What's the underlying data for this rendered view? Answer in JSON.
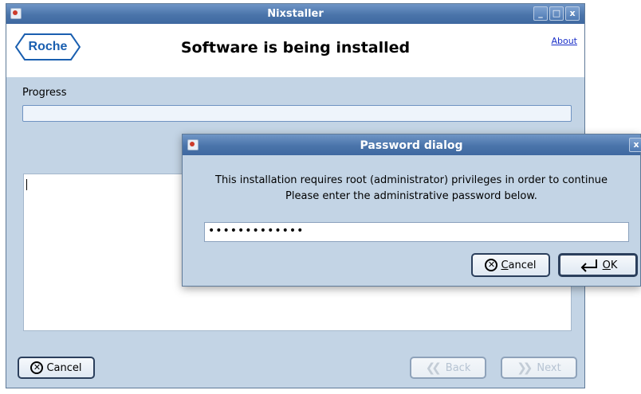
{
  "main_window": {
    "title": "Nixstaller",
    "buttons": {
      "minimize": "_",
      "maximize": "□",
      "close": "x"
    },
    "header": {
      "logo_text": "Roche",
      "page_title": "Software is being installed",
      "about_label": "About"
    },
    "progress": {
      "label": "Progress",
      "value": 0
    },
    "footer": {
      "cancel_label": "Cancel",
      "back_label": "Back",
      "next_label": "Next"
    }
  },
  "password_dialog": {
    "title": "Password dialog",
    "close_label": "x",
    "message_line1": "This installation requires root (administrator) privileges in order to continue",
    "message_line2": "Please enter the administrative password below.",
    "password_masked": "•••••••••••••",
    "cancel_label_first": "C",
    "cancel_label_rest": "ancel",
    "ok_label_first": "O",
    "ok_label_rest": "K"
  },
  "colors": {
    "window_bg": "#c3d4e5",
    "titlebar": "#4a74aa",
    "brand": "#1a5fb0",
    "link": "#1a2fc8"
  },
  "icons": [
    "app-icon",
    "cancel-icon",
    "back-icon",
    "next-icon",
    "ok-enter-icon"
  ]
}
